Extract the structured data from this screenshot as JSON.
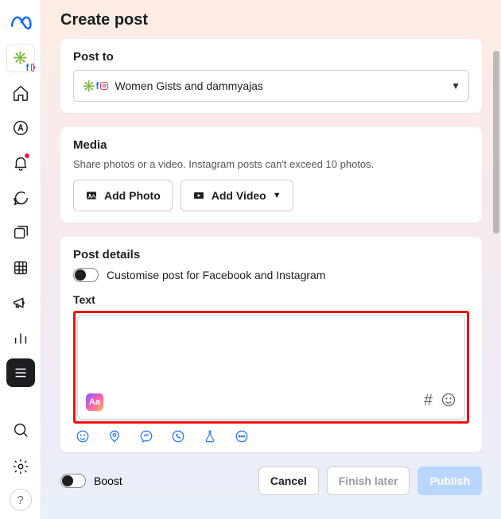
{
  "page": {
    "title": "Create post"
  },
  "post_to": {
    "heading": "Post to",
    "selected": "Women Gists and dammyajas"
  },
  "media": {
    "heading": "Media",
    "subtitle": "Share photos or a video. Instagram posts can't exceed 10 photos.",
    "add_photo": "Add Photo",
    "add_video": "Add Video"
  },
  "details": {
    "heading": "Post details",
    "customise_label": "Customise post for Facebook and Instagram",
    "text_label": "Text",
    "aa": "Aa",
    "hash": "#"
  },
  "boost": {
    "label": "Boost"
  },
  "footer": {
    "cancel": "Cancel",
    "finish_later": "Finish later",
    "publish": "Publish"
  },
  "help": "?"
}
